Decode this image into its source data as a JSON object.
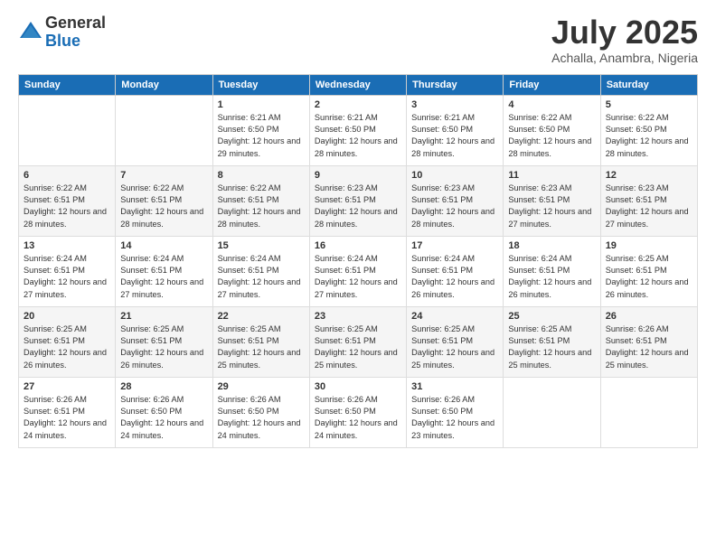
{
  "logo": {
    "general": "General",
    "blue": "Blue"
  },
  "title": "July 2025",
  "location": "Achalla, Anambra, Nigeria",
  "days_of_week": [
    "Sunday",
    "Monday",
    "Tuesday",
    "Wednesday",
    "Thursday",
    "Friday",
    "Saturday"
  ],
  "weeks": [
    [
      {
        "day": "",
        "info": ""
      },
      {
        "day": "",
        "info": ""
      },
      {
        "day": "1",
        "info": "Sunrise: 6:21 AM\nSunset: 6:50 PM\nDaylight: 12 hours and 29 minutes."
      },
      {
        "day": "2",
        "info": "Sunrise: 6:21 AM\nSunset: 6:50 PM\nDaylight: 12 hours and 28 minutes."
      },
      {
        "day": "3",
        "info": "Sunrise: 6:21 AM\nSunset: 6:50 PM\nDaylight: 12 hours and 28 minutes."
      },
      {
        "day": "4",
        "info": "Sunrise: 6:22 AM\nSunset: 6:50 PM\nDaylight: 12 hours and 28 minutes."
      },
      {
        "day": "5",
        "info": "Sunrise: 6:22 AM\nSunset: 6:50 PM\nDaylight: 12 hours and 28 minutes."
      }
    ],
    [
      {
        "day": "6",
        "info": "Sunrise: 6:22 AM\nSunset: 6:51 PM\nDaylight: 12 hours and 28 minutes."
      },
      {
        "day": "7",
        "info": "Sunrise: 6:22 AM\nSunset: 6:51 PM\nDaylight: 12 hours and 28 minutes."
      },
      {
        "day": "8",
        "info": "Sunrise: 6:22 AM\nSunset: 6:51 PM\nDaylight: 12 hours and 28 minutes."
      },
      {
        "day": "9",
        "info": "Sunrise: 6:23 AM\nSunset: 6:51 PM\nDaylight: 12 hours and 28 minutes."
      },
      {
        "day": "10",
        "info": "Sunrise: 6:23 AM\nSunset: 6:51 PM\nDaylight: 12 hours and 28 minutes."
      },
      {
        "day": "11",
        "info": "Sunrise: 6:23 AM\nSunset: 6:51 PM\nDaylight: 12 hours and 27 minutes."
      },
      {
        "day": "12",
        "info": "Sunrise: 6:23 AM\nSunset: 6:51 PM\nDaylight: 12 hours and 27 minutes."
      }
    ],
    [
      {
        "day": "13",
        "info": "Sunrise: 6:24 AM\nSunset: 6:51 PM\nDaylight: 12 hours and 27 minutes."
      },
      {
        "day": "14",
        "info": "Sunrise: 6:24 AM\nSunset: 6:51 PM\nDaylight: 12 hours and 27 minutes."
      },
      {
        "day": "15",
        "info": "Sunrise: 6:24 AM\nSunset: 6:51 PM\nDaylight: 12 hours and 27 minutes."
      },
      {
        "day": "16",
        "info": "Sunrise: 6:24 AM\nSunset: 6:51 PM\nDaylight: 12 hours and 27 minutes."
      },
      {
        "day": "17",
        "info": "Sunrise: 6:24 AM\nSunset: 6:51 PM\nDaylight: 12 hours and 26 minutes."
      },
      {
        "day": "18",
        "info": "Sunrise: 6:24 AM\nSunset: 6:51 PM\nDaylight: 12 hours and 26 minutes."
      },
      {
        "day": "19",
        "info": "Sunrise: 6:25 AM\nSunset: 6:51 PM\nDaylight: 12 hours and 26 minutes."
      }
    ],
    [
      {
        "day": "20",
        "info": "Sunrise: 6:25 AM\nSunset: 6:51 PM\nDaylight: 12 hours and 26 minutes."
      },
      {
        "day": "21",
        "info": "Sunrise: 6:25 AM\nSunset: 6:51 PM\nDaylight: 12 hours and 26 minutes."
      },
      {
        "day": "22",
        "info": "Sunrise: 6:25 AM\nSunset: 6:51 PM\nDaylight: 12 hours and 25 minutes."
      },
      {
        "day": "23",
        "info": "Sunrise: 6:25 AM\nSunset: 6:51 PM\nDaylight: 12 hours and 25 minutes."
      },
      {
        "day": "24",
        "info": "Sunrise: 6:25 AM\nSunset: 6:51 PM\nDaylight: 12 hours and 25 minutes."
      },
      {
        "day": "25",
        "info": "Sunrise: 6:25 AM\nSunset: 6:51 PM\nDaylight: 12 hours and 25 minutes."
      },
      {
        "day": "26",
        "info": "Sunrise: 6:26 AM\nSunset: 6:51 PM\nDaylight: 12 hours and 25 minutes."
      }
    ],
    [
      {
        "day": "27",
        "info": "Sunrise: 6:26 AM\nSunset: 6:51 PM\nDaylight: 12 hours and 24 minutes."
      },
      {
        "day": "28",
        "info": "Sunrise: 6:26 AM\nSunset: 6:50 PM\nDaylight: 12 hours and 24 minutes."
      },
      {
        "day": "29",
        "info": "Sunrise: 6:26 AM\nSunset: 6:50 PM\nDaylight: 12 hours and 24 minutes."
      },
      {
        "day": "30",
        "info": "Sunrise: 6:26 AM\nSunset: 6:50 PM\nDaylight: 12 hours and 24 minutes."
      },
      {
        "day": "31",
        "info": "Sunrise: 6:26 AM\nSunset: 6:50 PM\nDaylight: 12 hours and 23 minutes."
      },
      {
        "day": "",
        "info": ""
      },
      {
        "day": "",
        "info": ""
      }
    ]
  ]
}
